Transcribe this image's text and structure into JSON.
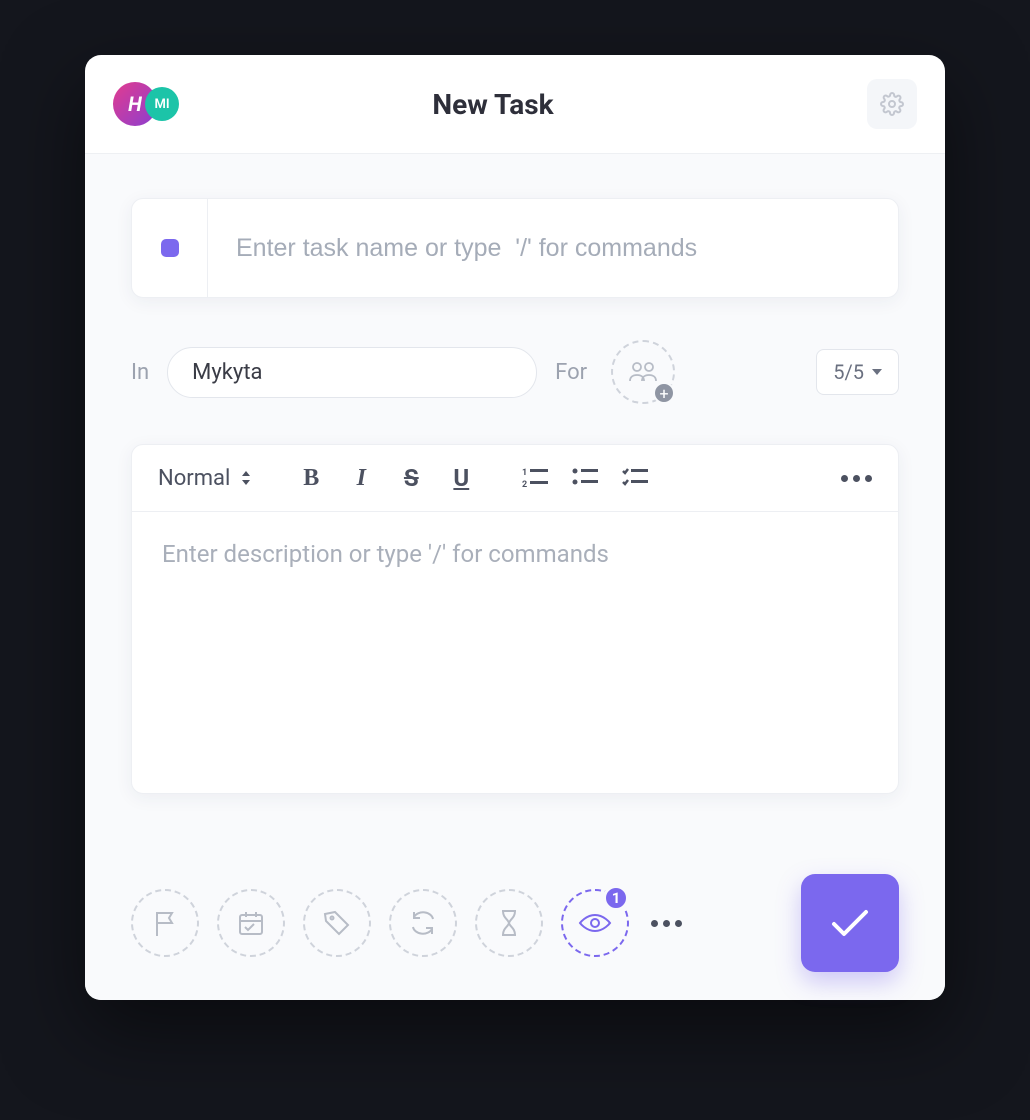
{
  "header": {
    "title": "New Task",
    "avatar_primary_initial": "H",
    "avatar_secondary_initials": "MI"
  },
  "inputs": {
    "task_name_placeholder": "Enter task name or type  '/' for commands",
    "description_placeholder": "Enter description or type '/' for commands"
  },
  "meta": {
    "in_label": "In",
    "list_name": "Mykyta",
    "for_label": "For",
    "count_label": "5/5"
  },
  "toolbar": {
    "heading_label": "Normal"
  },
  "footer": {
    "watchers_count": "1"
  }
}
